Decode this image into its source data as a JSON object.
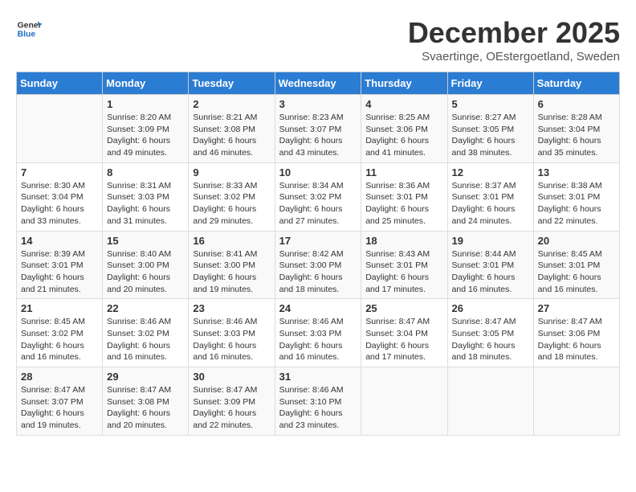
{
  "header": {
    "logo_line1": "General",
    "logo_line2": "Blue",
    "main_title": "December 2025",
    "subtitle": "Svaertinge, OEstergoetland, Sweden"
  },
  "days_of_week": [
    "Sunday",
    "Monday",
    "Tuesday",
    "Wednesday",
    "Thursday",
    "Friday",
    "Saturday"
  ],
  "weeks": [
    [
      {
        "day": "",
        "info": ""
      },
      {
        "day": "1",
        "info": "Sunrise: 8:20 AM\nSunset: 3:09 PM\nDaylight: 6 hours\nand 49 minutes."
      },
      {
        "day": "2",
        "info": "Sunrise: 8:21 AM\nSunset: 3:08 PM\nDaylight: 6 hours\nand 46 minutes."
      },
      {
        "day": "3",
        "info": "Sunrise: 8:23 AM\nSunset: 3:07 PM\nDaylight: 6 hours\nand 43 minutes."
      },
      {
        "day": "4",
        "info": "Sunrise: 8:25 AM\nSunset: 3:06 PM\nDaylight: 6 hours\nand 41 minutes."
      },
      {
        "day": "5",
        "info": "Sunrise: 8:27 AM\nSunset: 3:05 PM\nDaylight: 6 hours\nand 38 minutes."
      },
      {
        "day": "6",
        "info": "Sunrise: 8:28 AM\nSunset: 3:04 PM\nDaylight: 6 hours\nand 35 minutes."
      }
    ],
    [
      {
        "day": "7",
        "info": "Sunrise: 8:30 AM\nSunset: 3:04 PM\nDaylight: 6 hours\nand 33 minutes."
      },
      {
        "day": "8",
        "info": "Sunrise: 8:31 AM\nSunset: 3:03 PM\nDaylight: 6 hours\nand 31 minutes."
      },
      {
        "day": "9",
        "info": "Sunrise: 8:33 AM\nSunset: 3:02 PM\nDaylight: 6 hours\nand 29 minutes."
      },
      {
        "day": "10",
        "info": "Sunrise: 8:34 AM\nSunset: 3:02 PM\nDaylight: 6 hours\nand 27 minutes."
      },
      {
        "day": "11",
        "info": "Sunrise: 8:36 AM\nSunset: 3:01 PM\nDaylight: 6 hours\nand 25 minutes."
      },
      {
        "day": "12",
        "info": "Sunrise: 8:37 AM\nSunset: 3:01 PM\nDaylight: 6 hours\nand 24 minutes."
      },
      {
        "day": "13",
        "info": "Sunrise: 8:38 AM\nSunset: 3:01 PM\nDaylight: 6 hours\nand 22 minutes."
      }
    ],
    [
      {
        "day": "14",
        "info": "Sunrise: 8:39 AM\nSunset: 3:01 PM\nDaylight: 6 hours\nand 21 minutes."
      },
      {
        "day": "15",
        "info": "Sunrise: 8:40 AM\nSunset: 3:00 PM\nDaylight: 6 hours\nand 20 minutes."
      },
      {
        "day": "16",
        "info": "Sunrise: 8:41 AM\nSunset: 3:00 PM\nDaylight: 6 hours\nand 19 minutes."
      },
      {
        "day": "17",
        "info": "Sunrise: 8:42 AM\nSunset: 3:00 PM\nDaylight: 6 hours\nand 18 minutes."
      },
      {
        "day": "18",
        "info": "Sunrise: 8:43 AM\nSunset: 3:01 PM\nDaylight: 6 hours\nand 17 minutes."
      },
      {
        "day": "19",
        "info": "Sunrise: 8:44 AM\nSunset: 3:01 PM\nDaylight: 6 hours\nand 16 minutes."
      },
      {
        "day": "20",
        "info": "Sunrise: 8:45 AM\nSunset: 3:01 PM\nDaylight: 6 hours\nand 16 minutes."
      }
    ],
    [
      {
        "day": "21",
        "info": "Sunrise: 8:45 AM\nSunset: 3:02 PM\nDaylight: 6 hours\nand 16 minutes."
      },
      {
        "day": "22",
        "info": "Sunrise: 8:46 AM\nSunset: 3:02 PM\nDaylight: 6 hours\nand 16 minutes."
      },
      {
        "day": "23",
        "info": "Sunrise: 8:46 AM\nSunset: 3:03 PM\nDaylight: 6 hours\nand 16 minutes."
      },
      {
        "day": "24",
        "info": "Sunrise: 8:46 AM\nSunset: 3:03 PM\nDaylight: 6 hours\nand 16 minutes."
      },
      {
        "day": "25",
        "info": "Sunrise: 8:47 AM\nSunset: 3:04 PM\nDaylight: 6 hours\nand 17 minutes."
      },
      {
        "day": "26",
        "info": "Sunrise: 8:47 AM\nSunset: 3:05 PM\nDaylight: 6 hours\nand 18 minutes."
      },
      {
        "day": "27",
        "info": "Sunrise: 8:47 AM\nSunset: 3:06 PM\nDaylight: 6 hours\nand 18 minutes."
      }
    ],
    [
      {
        "day": "28",
        "info": "Sunrise: 8:47 AM\nSunset: 3:07 PM\nDaylight: 6 hours\nand 19 minutes."
      },
      {
        "day": "29",
        "info": "Sunrise: 8:47 AM\nSunset: 3:08 PM\nDaylight: 6 hours\nand 20 minutes."
      },
      {
        "day": "30",
        "info": "Sunrise: 8:47 AM\nSunset: 3:09 PM\nDaylight: 6 hours\nand 22 minutes."
      },
      {
        "day": "31",
        "info": "Sunrise: 8:46 AM\nSunset: 3:10 PM\nDaylight: 6 hours\nand 23 minutes."
      },
      {
        "day": "",
        "info": ""
      },
      {
        "day": "",
        "info": ""
      },
      {
        "day": "",
        "info": ""
      }
    ]
  ]
}
